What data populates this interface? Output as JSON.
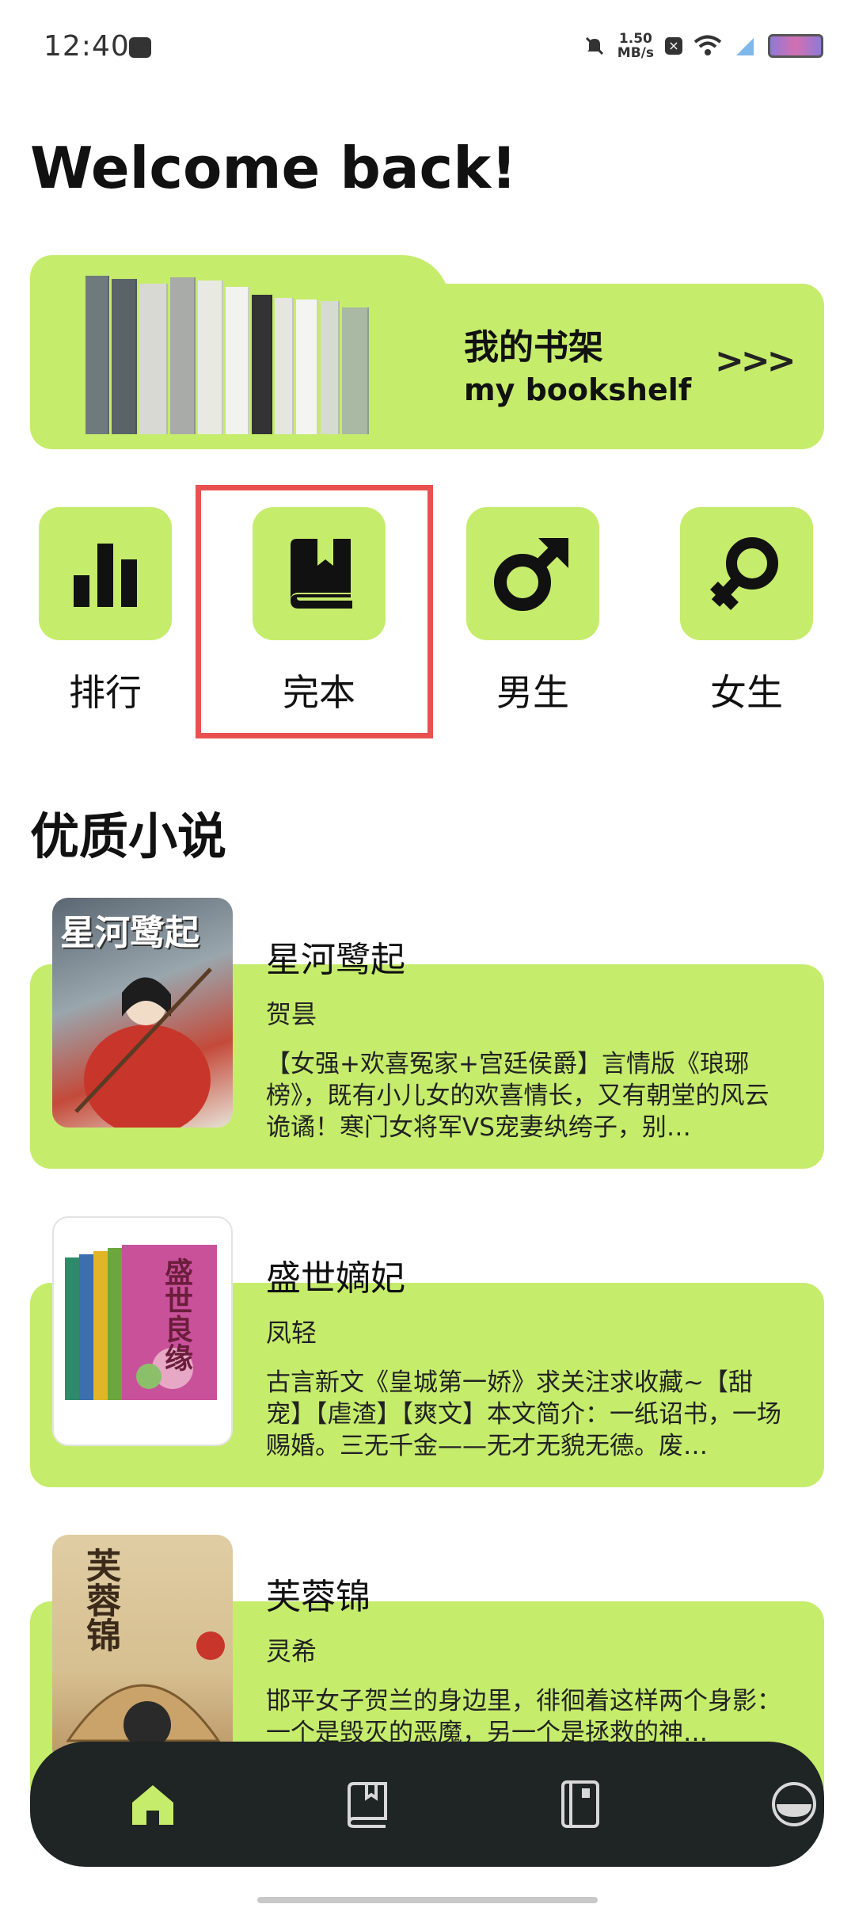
{
  "status": {
    "time": "12:40",
    "speed_value": "1.50",
    "speed_unit": "MB/s"
  },
  "header": {
    "welcome": "Welcome back!"
  },
  "bookshelf": {
    "title_cn": "我的书架",
    "title_en": "my bookshelf",
    "arrows": ">>>"
  },
  "categories": [
    {
      "label": "排行",
      "icon": "bar-chart-icon"
    },
    {
      "label": "完本",
      "icon": "book-icon"
    },
    {
      "label": "男生",
      "icon": "male-icon"
    },
    {
      "label": "女生",
      "icon": "female-icon"
    }
  ],
  "section": {
    "title": "优质小说"
  },
  "novels": [
    {
      "title": "星河鹭起",
      "author": "贺昙",
      "description": "【女强+欢喜冤家+宫廷侯爵】言情版《琅琊榜》，既有小儿女的欢喜情长，又有朝堂的风云诡谲！寒门女将军VS宠妻纨绔子，别…",
      "cover_text": "星河鹭起"
    },
    {
      "title": "盛世嫡妃",
      "author": "凤轻",
      "description": "古言新文《皇城第一娇》求关注求收藏~【甜宠】【虐渣】【爽文】本文简介：一纸诏书，一场赐婚。三无千金——无才无貌无德。废…",
      "cover_text": "盛世良缘"
    },
    {
      "title": "芙蓉锦",
      "author": "灵希",
      "description": "邯平女子贺兰的身边里，徘徊着这样两个身影：一个是毁灭的恶魔，另一个是拯救的神…",
      "cover_text": "芙蓉锦"
    }
  ],
  "nav": [
    "home-icon",
    "bookshelf-icon",
    "notebook-icon",
    "profile-icon"
  ],
  "colors": {
    "accent": "#c6ec6c",
    "nav_bg": "#1f2424",
    "nav_active": "#c6ec6c",
    "highlight": "#e8514f"
  }
}
